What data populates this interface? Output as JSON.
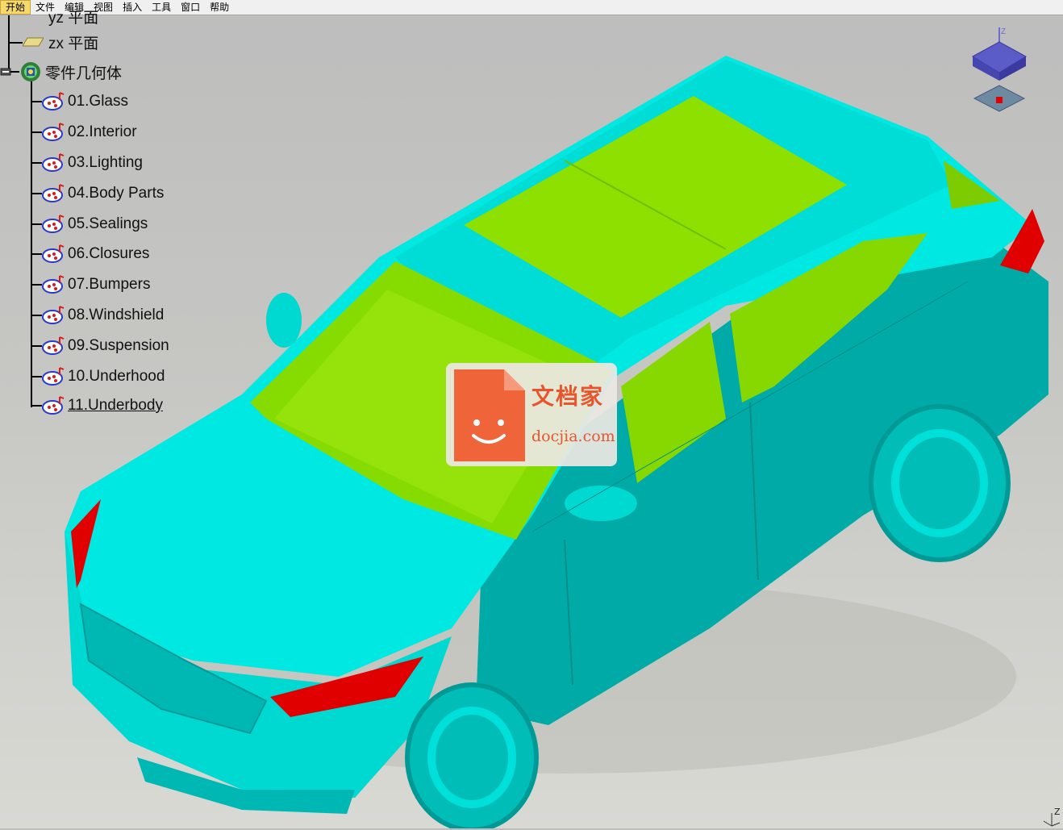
{
  "menubar": {
    "items": [
      "开始",
      "文件",
      "编辑",
      "视图",
      "插入",
      "工具",
      "窗口",
      "帮助"
    ]
  },
  "tree": {
    "partial_top_label": "yz 平面",
    "plane_zx": "zx 平面",
    "body": "零件几何体",
    "geosets": [
      "01.Glass",
      "02.Interior",
      "03.Lighting",
      "04.Body Parts",
      "05.Sealings",
      "06.Closures",
      "07.Bumpers",
      "08.Windshield",
      "09.Suspension",
      "10.Underhood",
      "11.Underbody"
    ]
  },
  "watermark": {
    "title": "文档家",
    "site": "docjia.com"
  },
  "compass": {
    "z_label": "Z"
  },
  "axis": {
    "label": "Z"
  },
  "colors": {
    "car_body": "#00e6e0",
    "car_shadow": "#00a8a4",
    "glass": "#88e000",
    "lamp": "#e00000",
    "watermark_accent": "#f0643a"
  }
}
